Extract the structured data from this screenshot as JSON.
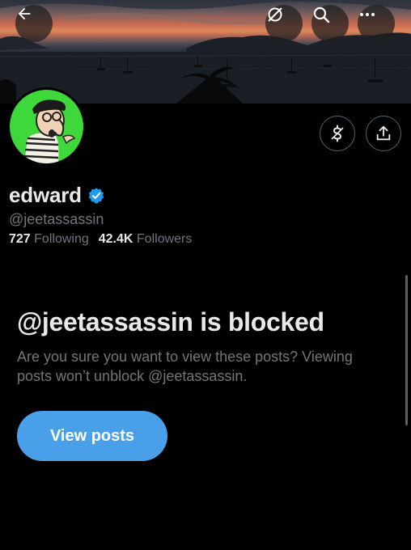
{
  "header": {
    "back_icon": "arrow-left-icon",
    "icons": [
      "grok-icon",
      "search-icon",
      "more-icon"
    ]
  },
  "profile": {
    "display_name": "edward",
    "verified_icon": "verified-badge-icon",
    "handle": "@jeetassassin",
    "following_count": "727",
    "following_label": "Following",
    "followers_count": "42.4K",
    "followers_label": "Followers",
    "action_icons": [
      "subscribe-dollar-icon",
      "share-icon"
    ]
  },
  "blocked": {
    "title": "@jeetassassin is blocked",
    "description": "Are you sure you want to view these posts? Viewing posts won’t unblock @jeetassassin.",
    "button_label": "View posts"
  },
  "colors": {
    "background": "#000000",
    "text_primary": "#e7e9ea",
    "text_secondary": "#71767b",
    "accent": "#4aa0e8",
    "verified": "#1d9bf0",
    "avatar_bg": "#3fd83a"
  }
}
